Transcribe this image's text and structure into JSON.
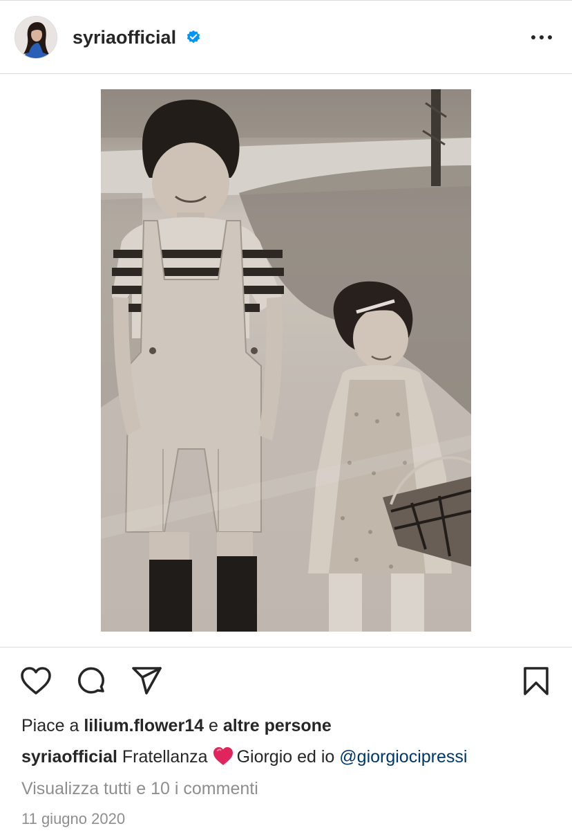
{
  "post": {
    "username": "syriaofficial",
    "verified": true,
    "likes_prefix": "Piace a",
    "liked_by": "lilium.flower14",
    "likes_joiner": "e",
    "likes_others": "altre persone",
    "caption_username": "syriaofficial",
    "caption_text_before": "Fratellanza",
    "caption_emoji": "red-heart",
    "caption_text_after": "Giorgio ed io",
    "caption_mention": "@giorgiocipressi",
    "comments_link": "Visualizza tutti e 10 i commenti",
    "date": "11 giugno 2020"
  },
  "icons": {
    "more": "more-horizontal-icon",
    "like": "heart-outline-icon",
    "comment": "comment-bubble-icon",
    "share": "paper-plane-icon",
    "save": "bookmark-outline-icon",
    "verified": "verified-badge-icon"
  },
  "colors": {
    "text": "#262626",
    "secondary_text": "#8e8e8e",
    "mention": "#00376b",
    "verified_badge": "#0095f6",
    "divider": "#dbdbdb",
    "heart_emoji": "#e0245e"
  }
}
